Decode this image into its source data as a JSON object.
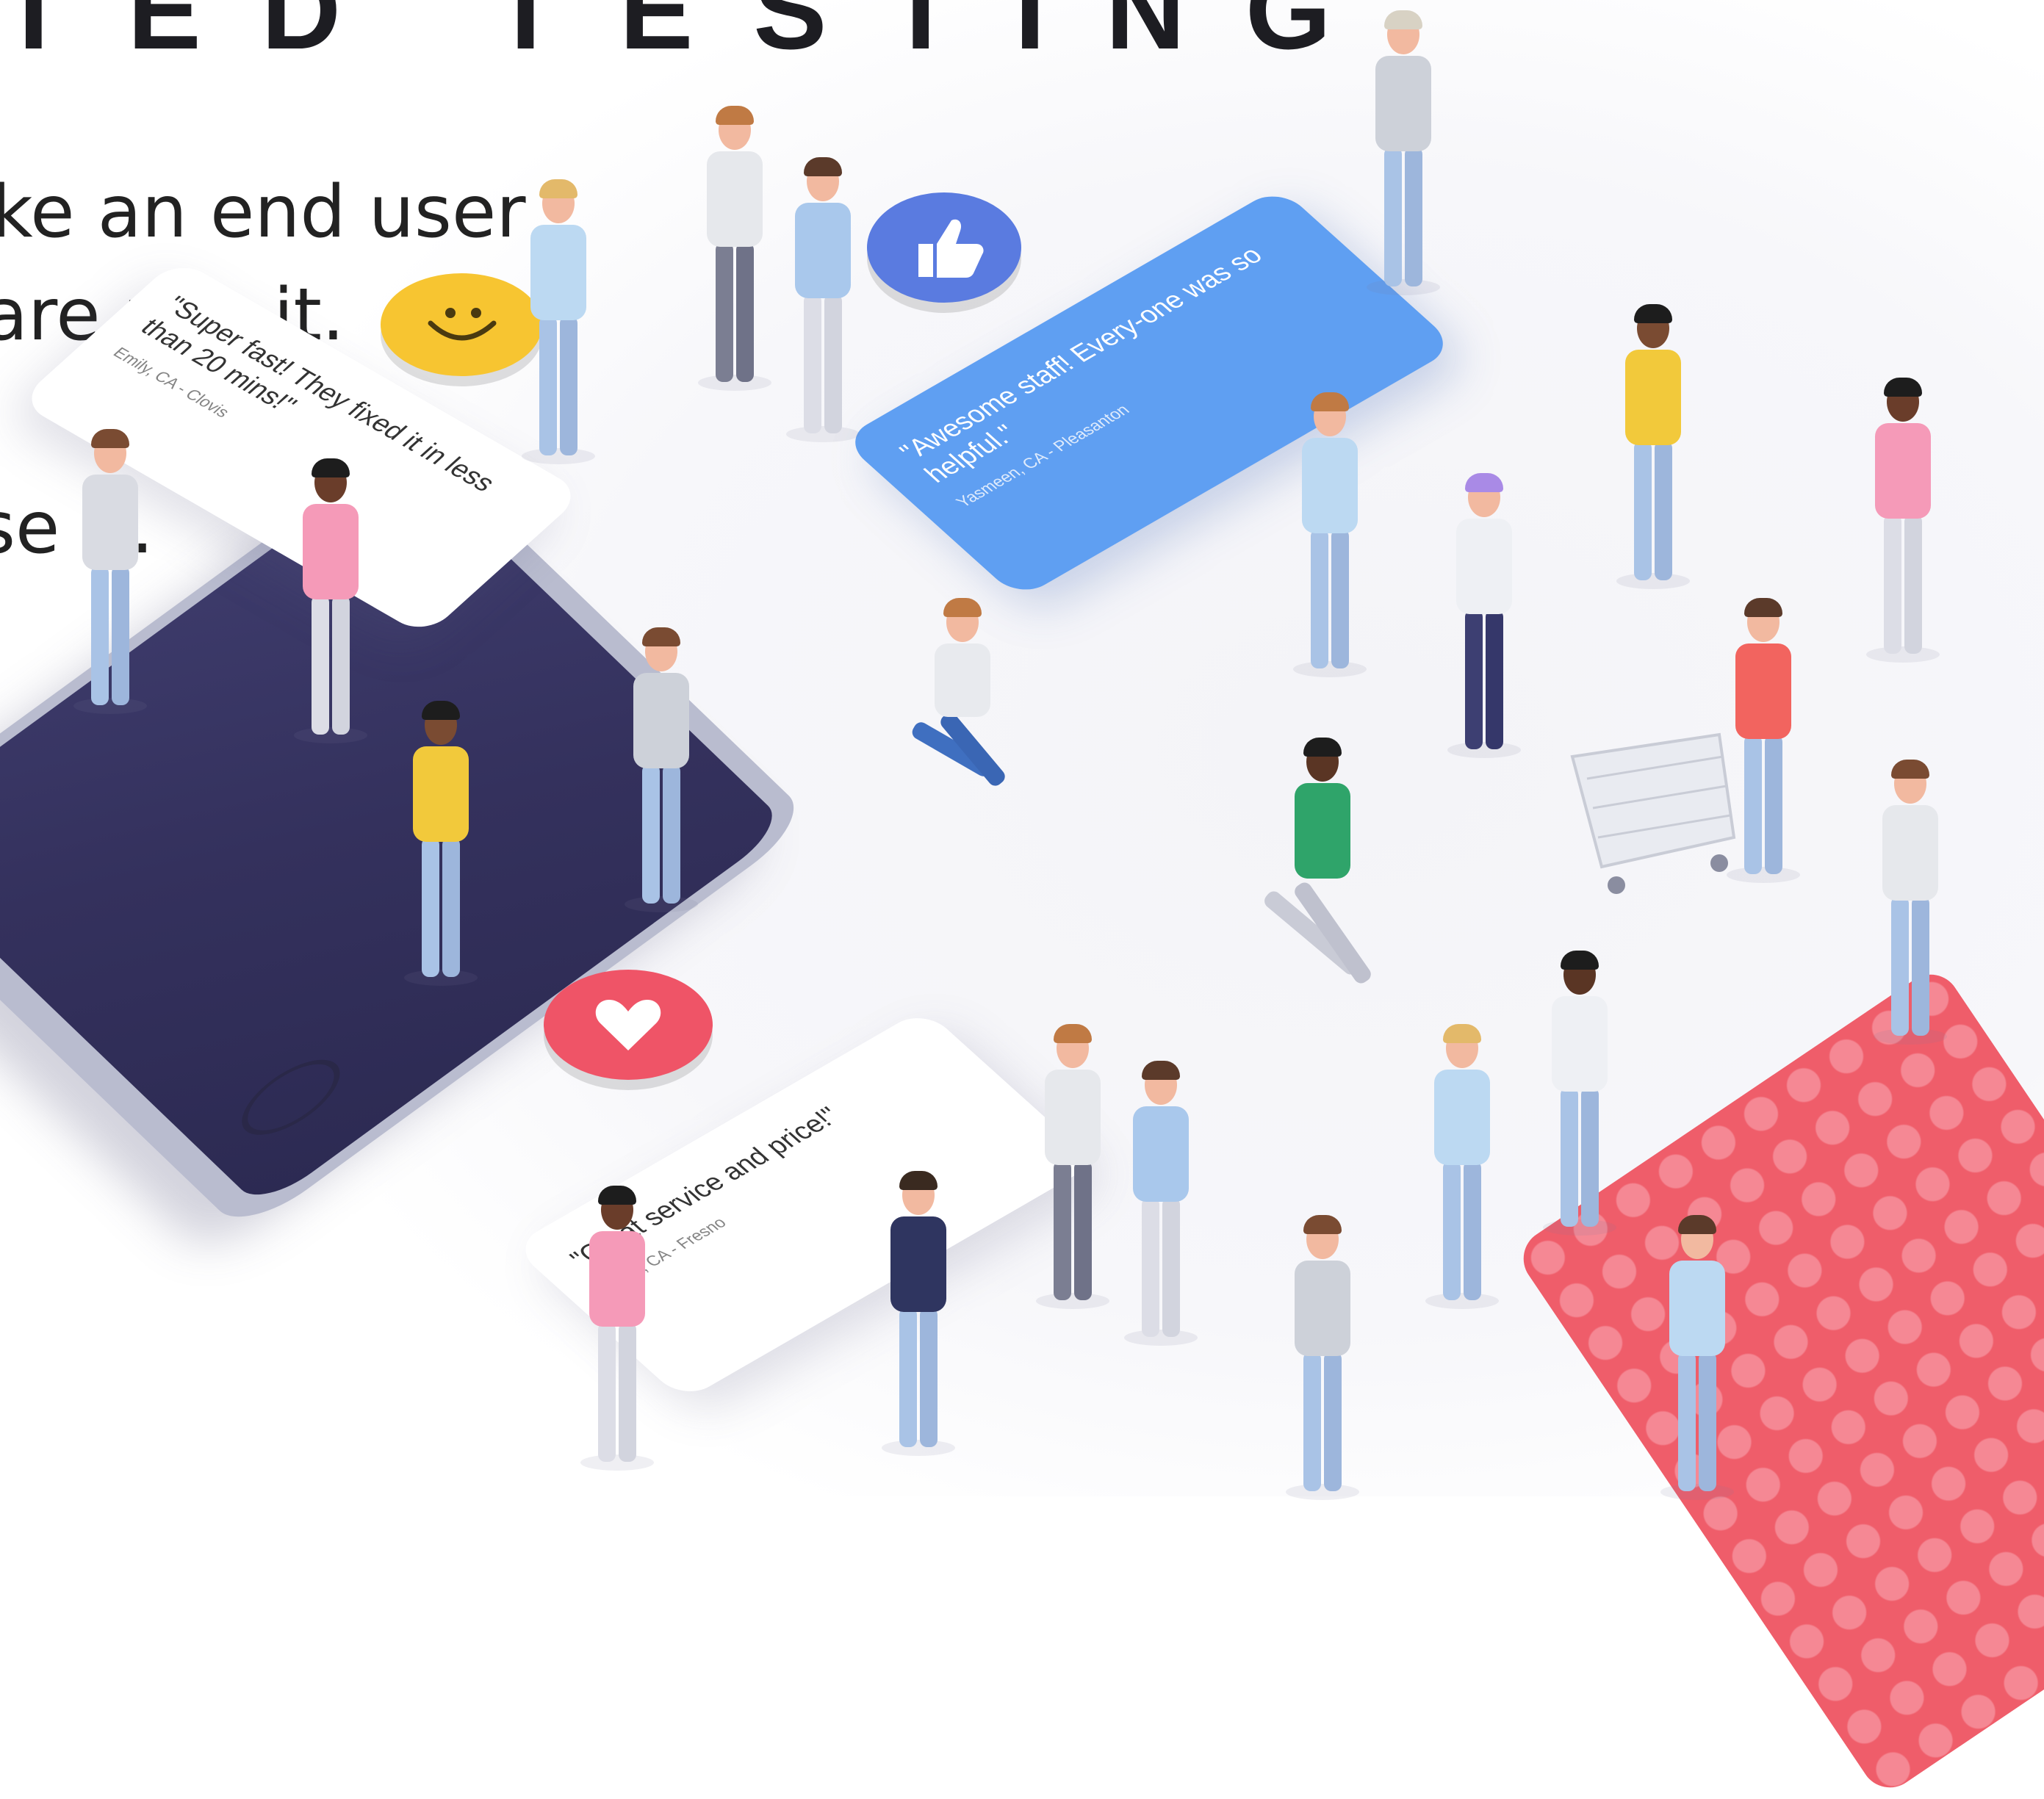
{
  "title": "TED TESTING",
  "body_lines": [
    "ke an end user",
    "are use it.",
    "se it."
  ],
  "testimonials": [
    {
      "quote": "\"Super fast! They fixed it in less than 20 mins!\"",
      "author": "Emily, CA - Clovis"
    },
    {
      "quote": "\"Awesome staff! Every-one was so helpful.\"",
      "author": "Yasmeen, CA - Pleasanton"
    },
    {
      "quote": "\"Great service and price!\"",
      "author": "David, CA - Fresno"
    }
  ],
  "icons": {
    "thumbs_up": "thumbs-up-icon",
    "smiley": "smiley-icon",
    "heart": "heart-icon"
  },
  "colors": {
    "blue_bubble": "#5f9ff2",
    "thumbs_badge": "#5a7be0",
    "smiley_badge": "#f7c531",
    "heart_badge": "#ef5467",
    "phone_screen": "#3a3766",
    "mat": "#ef5d6a"
  }
}
